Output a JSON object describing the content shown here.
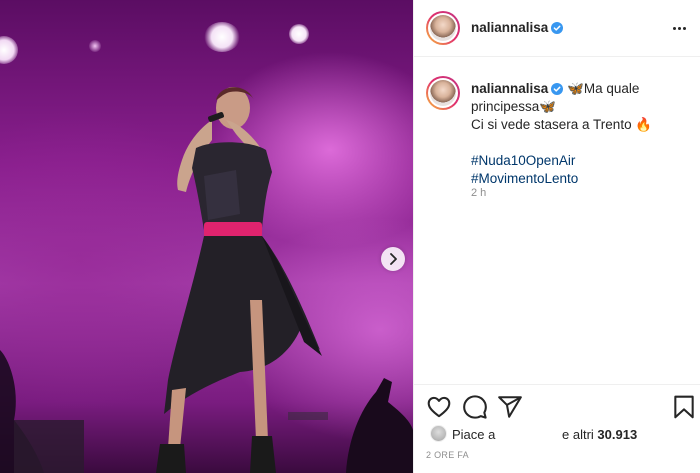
{
  "post": {
    "username": "naliannalisa",
    "verified": true,
    "caption_line1": "Ma quale",
    "caption_line2": "principessa",
    "caption_line3": "Ci si vede stasera a Trento",
    "caption_emoji_butterfly": "🦋",
    "caption_emoji_fire": "🔥",
    "hashtags": [
      "#Nuda10OpenAir",
      "#MovimentoLento"
    ],
    "time_ago": "2 h",
    "likes_prefix": "Piace a",
    "likes_suffix_text": "e altri ",
    "likes_count": "30.913",
    "post_date": "2 ORE FA"
  },
  "icons": {
    "header_more": "more-options-icon",
    "verified": "verified-badge-icon",
    "next": "chevron-right-icon",
    "like": "heart-icon",
    "comment": "comment-bubble-icon",
    "share": "paper-plane-icon",
    "save": "bookmark-icon"
  },
  "colors": {
    "verified_blue": "#3897f0",
    "hashtag": "#00376b",
    "muted": "#8e8e8e"
  }
}
